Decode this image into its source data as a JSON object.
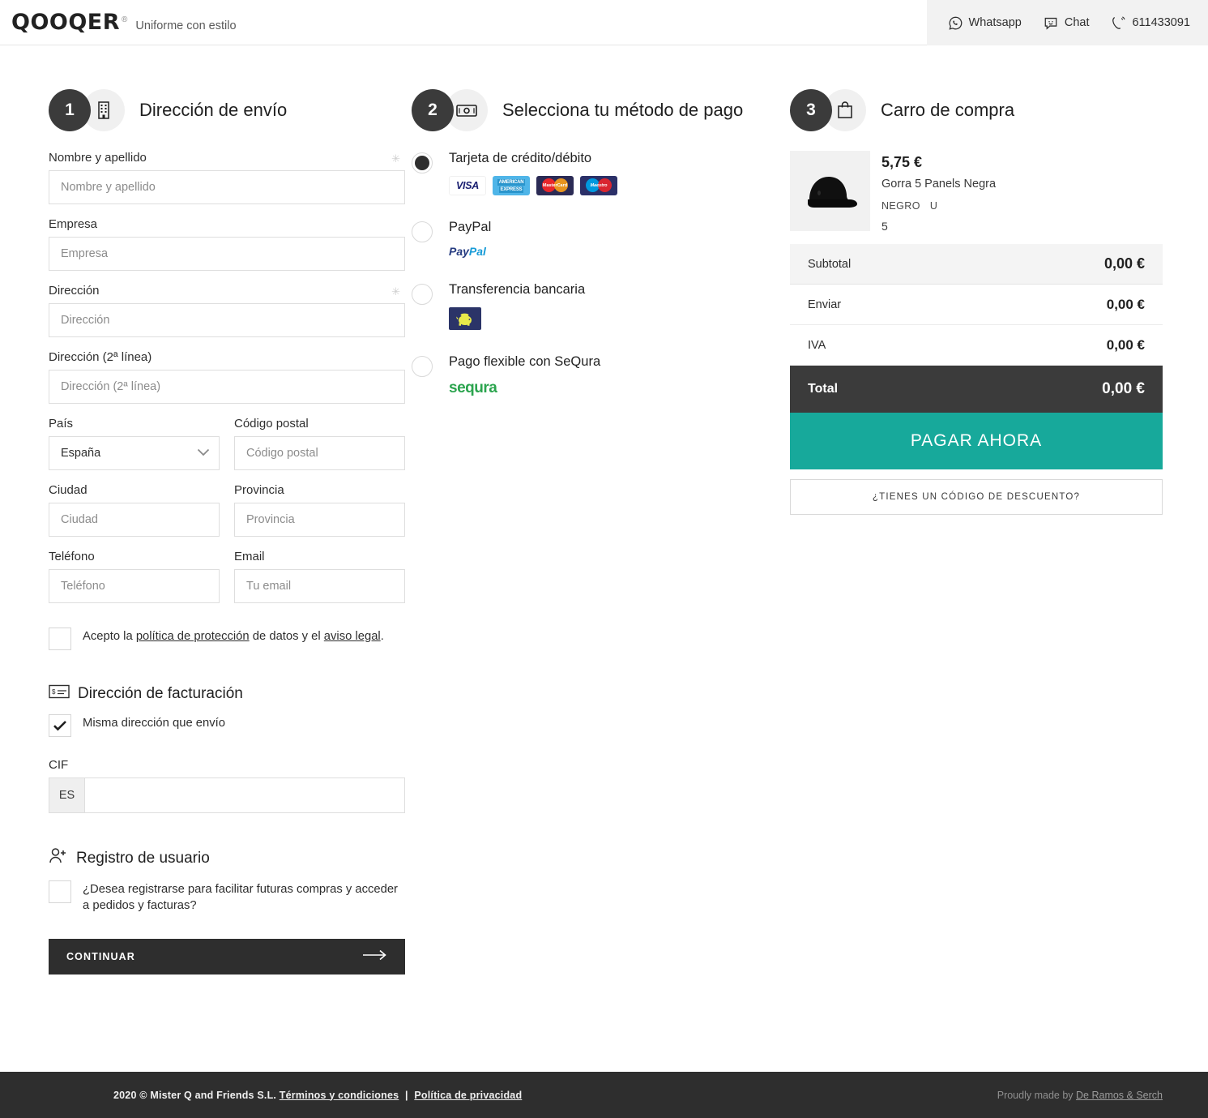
{
  "header": {
    "logo": "QOOQER",
    "registered_mark": "®",
    "tagline": "Uniforme con estilo",
    "contacts": [
      {
        "icon": "whatsapp-icon",
        "label": "Whatsapp"
      },
      {
        "icon": "chat-icon",
        "label": "Chat"
      },
      {
        "icon": "phone-icon",
        "label": "611433091"
      }
    ]
  },
  "shipping": {
    "step_number": "1",
    "icon": "building-icon",
    "title": "Dirección de envío",
    "required_mark": "✳",
    "fields": {
      "name": {
        "label": "Nombre y apellido",
        "placeholder": "Nombre y apellido",
        "value": "",
        "required": true
      },
      "company": {
        "label": "Empresa",
        "placeholder": "Empresa",
        "value": ""
      },
      "address1": {
        "label": "Dirección",
        "placeholder": "Dirección",
        "value": "",
        "required": true
      },
      "address2": {
        "label": "Dirección (2ª línea)",
        "placeholder": "Dirección (2ª línea)",
        "value": ""
      },
      "country": {
        "label": "País",
        "value": "España",
        "options": [
          "España"
        ]
      },
      "postcode": {
        "label": "Código postal",
        "placeholder": "Código postal",
        "value": ""
      },
      "city": {
        "label": "Ciudad",
        "placeholder": "Ciudad",
        "value": ""
      },
      "province": {
        "label": "Provincia",
        "placeholder": "Provincia",
        "value": ""
      },
      "phone": {
        "label": "Teléfono",
        "placeholder": "Teléfono",
        "value": ""
      },
      "email": {
        "label": "Email",
        "placeholder": "Tu email",
        "value": ""
      }
    },
    "consent": {
      "checked": false,
      "text_before": "Acepto la ",
      "link1": "política de protección",
      "text_middle": " de datos y el ",
      "link2": "aviso legal",
      "text_after": "."
    },
    "billing": {
      "icon": "billing-card-icon",
      "title": "Dirección de facturación",
      "same_address_label": "Misma dirección que envío",
      "same_address_checked": true,
      "cif_label": "CIF",
      "cif_prefix": "ES",
      "cif_value": ""
    },
    "registration": {
      "icon": "user-plus-icon",
      "title": "Registro de usuario",
      "question": "¿Desea registrarse para facilitar futuras compras y acceder a pedidos y facturas?",
      "checked": false
    },
    "continue_button": "CONTINUAR"
  },
  "payment": {
    "step_number": "2",
    "icon": "banknote-icon",
    "title": "Selecciona tu método de pago",
    "options": [
      {
        "id": "card",
        "label": "Tarjeta de crédito/débito",
        "selected": true,
        "logos": [
          "VISA",
          "AMERICAN EXPRESS",
          "MasterCard",
          "Maestro"
        ]
      },
      {
        "id": "paypal",
        "label": "PayPal",
        "selected": false,
        "logos": [
          "PayPal"
        ]
      },
      {
        "id": "transfer",
        "label": "Transferencia bancaria",
        "selected": false,
        "logos": [
          "piggy-bank-icon"
        ]
      },
      {
        "id": "sequra",
        "label": "Pago flexible con SeQura",
        "selected": false,
        "logos": [
          "sequra"
        ]
      }
    ]
  },
  "cart": {
    "step_number": "3",
    "icon": "shopping-bag-icon",
    "title": "Carro de compra",
    "item": {
      "price": "5,75 €",
      "name": "Gorra 5 Panels Negra",
      "color": "NEGRO",
      "size": "U",
      "quantity": "5",
      "image_alt": "black-cap-thumbnail"
    },
    "summary": [
      {
        "label": "Subtotal",
        "amount": "0,00 €",
        "style": "shaded"
      },
      {
        "label": "Enviar",
        "amount": "0,00 €",
        "style": "plain"
      },
      {
        "label": "IVA",
        "amount": "0,00 €",
        "style": "plain"
      },
      {
        "label": "Total",
        "amount": "0,00 €",
        "style": "total"
      }
    ],
    "pay_button": "PAGAR AHORA",
    "discount_button": "¿TIENES UN CÓDIGO DE DESCUENTO?"
  },
  "footer": {
    "copyright": "2020 © Mister Q and Friends S.L.",
    "terms_link": "Términos y condiciones",
    "separator": "|",
    "privacy_link": "Política de privacidad",
    "credit_prefix": "Proudly made by ",
    "credit_link": "De Ramos & Serch"
  },
  "colors": {
    "accent_teal": "#17A99B",
    "dark": "#2E2E2E",
    "step_badge": "#3B3B3B",
    "sequra_green": "#2BA44E",
    "piggy_navy": "#2B3468"
  }
}
